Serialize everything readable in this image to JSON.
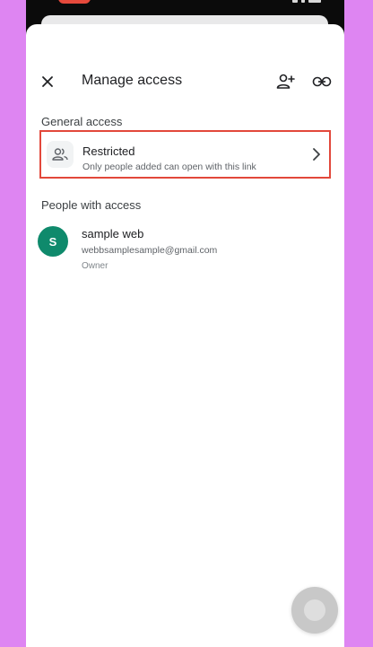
{
  "header": {
    "title": "Manage access",
    "close_icon": "close-icon",
    "add_person_icon": "person-add-icon",
    "link_icon": "link-icon"
  },
  "general_access": {
    "section_label": "General access",
    "setting_title": "Restricted",
    "setting_description": "Only people added can open with this link",
    "icon": "people-icon",
    "highlight_color": "#e2483b"
  },
  "people": {
    "section_label": "People with access",
    "items": [
      {
        "initial": "S",
        "name": "sample web",
        "email": "webbsamplesample@gmail.com",
        "role": "Owner",
        "avatar_color": "#0f8a6c"
      }
    ]
  },
  "colors": {
    "background": "#de85f2",
    "sheet": "#ffffff"
  }
}
